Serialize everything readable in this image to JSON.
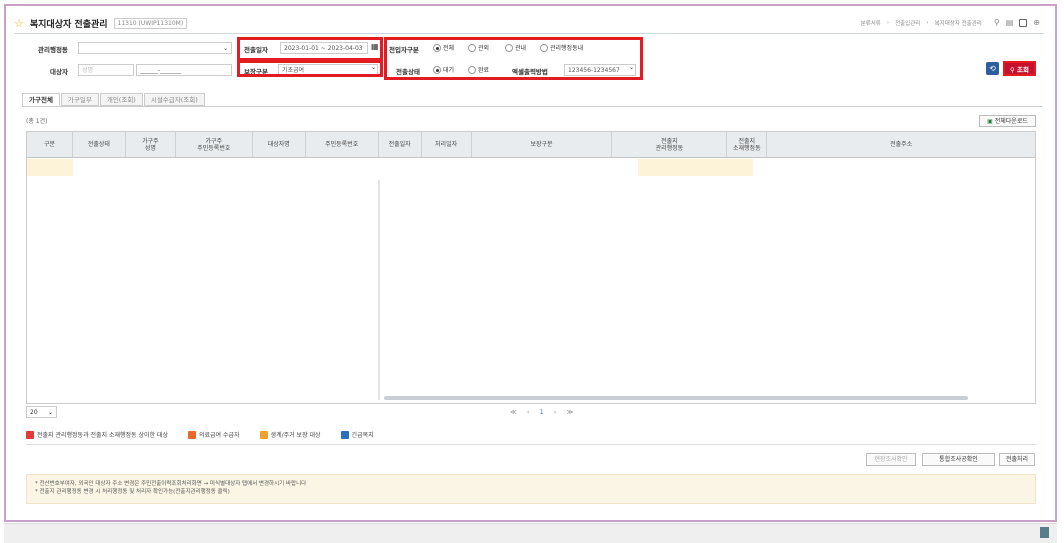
{
  "header": {
    "title": "복지대상자 전출관리",
    "program_id": "11310 (UWIP11310M)",
    "breadcrumb": [
      "분류서류",
      "전출입관리",
      "복지대상자 전출관리"
    ]
  },
  "filters": {
    "admin_dong_label": "관리행정동",
    "target_label": "대상자",
    "target_name_placeholder": "성명",
    "target_rrn_value": "______-_______",
    "transfer_date_label": "전출일자",
    "transfer_date_value": "2023-01-01 ~ 2023-04-03",
    "protection_label": "보장구분",
    "protection_value": "기초급여",
    "entry_type_label": "전입자구분",
    "entry_type_options": [
      "전체",
      "관외",
      "관내",
      "관리행정동내"
    ],
    "transfer_status_label": "전출상태",
    "transfer_status_options": [
      "대기",
      "완료"
    ],
    "excel_method_label": "엑셀출력방법",
    "excel_method_value": "123456-1234567"
  },
  "buttons": {
    "search": "조회",
    "excel_download": "전체다운로드",
    "confirm_survey": "현장조사확인",
    "integrated_notice": "통합조사공확인",
    "transfer_process": "전출처리"
  },
  "tabs": [
    "가구전체",
    "가구일부",
    "개인(조회)",
    "시설수급자(조회)"
  ],
  "grid": {
    "count_text": "(총 1건)",
    "columns": [
      "구분",
      "전출상태",
      "가구주\n성명",
      "가구주\n주민등록번호",
      "대상자명",
      "주민등록번호",
      "전출일자",
      "처리일자",
      "보장구분",
      "전출지\n관리행정동",
      "전출지\n소재행정동",
      "전출주소"
    ]
  },
  "pager": {
    "page_size": "20",
    "nav": "≪ ‹",
    "current": "1",
    "nav_next": "› ≫"
  },
  "legend": [
    {
      "label": "전출지 관리행정동과 전출지 소재행정동 상이한 대상",
      "color": "#e03a3a"
    },
    {
      "label": "의료급여 수급자",
      "color": "#e8692a"
    },
    {
      "label": "생계/주거 보장 대상",
      "color": "#f0a030"
    },
    {
      "label": "긴급복지",
      "color": "#2c6fc0"
    }
  ],
  "notes": [
    "* 전산번호부여자, 외국인 대상자 주소 변경은 주민전출이력조회처리화면 → 미식별대상자 탭에서 변경하시기 바랍니다",
    "* 전출지 관리행정동 변경 시 처리행정동 및 처리자 확인가능(전출지관리행정동 클릭)"
  ],
  "colors": {
    "accent": "#e31b23",
    "search_button": "#c8102e",
    "reset_button": "#2c5d9c",
    "highlight_cell": "#fdf3d8"
  }
}
